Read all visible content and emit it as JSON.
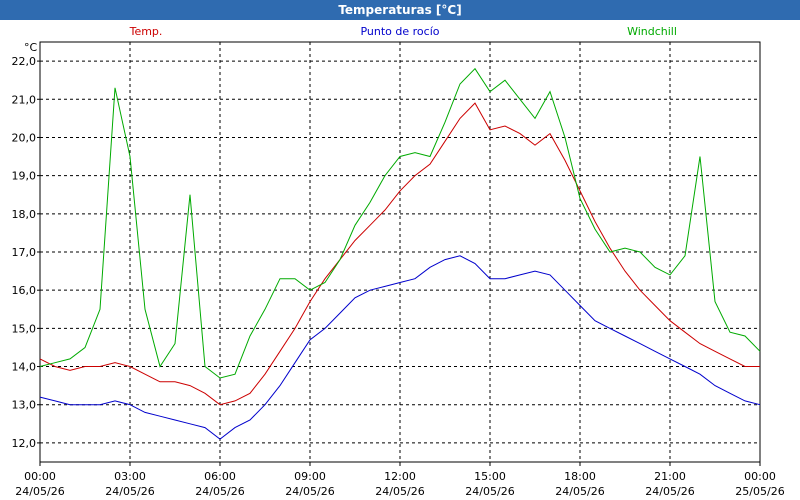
{
  "window": {
    "title": "Temperaturas [°C]"
  },
  "colors": {
    "temp": "#cc0000",
    "dew": "#0000cc",
    "wind": "#00aa00",
    "titlebar": "#2f6bb0"
  },
  "chart_data": {
    "type": "line",
    "title": "Temperaturas [°C]",
    "ylabel": "°C",
    "ylim": [
      11.5,
      22.5
    ],
    "grid": true,
    "legend_position": "top",
    "yticks": [
      "12,0",
      "13,0",
      "14,0",
      "15,0",
      "16,0",
      "17,0",
      "18,0",
      "19,0",
      "20,0",
      "21,0",
      "22,0"
    ],
    "xticks": [
      {
        "time": "00:00",
        "date": "24/05/26"
      },
      {
        "time": "03:00",
        "date": "24/05/26"
      },
      {
        "time": "06:00",
        "date": "24/05/26"
      },
      {
        "time": "09:00",
        "date": "24/05/26"
      },
      {
        "time": "12:00",
        "date": "24/05/26"
      },
      {
        "time": "15:00",
        "date": "24/05/26"
      },
      {
        "time": "18:00",
        "date": "24/05/26"
      },
      {
        "time": "21:00",
        "date": "24/05/26"
      },
      {
        "time": "00:00",
        "date": "25/05/26"
      }
    ],
    "x_hours": [
      0,
      0.5,
      1,
      1.5,
      2,
      2.5,
      3,
      3.5,
      4,
      4.5,
      5,
      5.5,
      6,
      6.5,
      7,
      7.5,
      8,
      8.5,
      9,
      9.5,
      10,
      10.5,
      11,
      11.5,
      12,
      12.5,
      13,
      13.5,
      14,
      14.5,
      15,
      15.5,
      16,
      16.5,
      17,
      17.5,
      18,
      18.5,
      19,
      19.5,
      20,
      20.5,
      21,
      21.5,
      22,
      22.5,
      23,
      23.5,
      24
    ],
    "series": [
      {
        "name": "Temp.",
        "color": "#cc0000",
        "values": [
          14.2,
          14.0,
          13.9,
          14.0,
          14.0,
          14.1,
          14.0,
          13.8,
          13.6,
          13.6,
          13.5,
          13.3,
          13.0,
          13.1,
          13.3,
          13.8,
          14.4,
          15.0,
          15.7,
          16.3,
          16.8,
          17.3,
          17.7,
          18.1,
          18.6,
          19.0,
          19.3,
          19.9,
          20.5,
          20.9,
          20.2,
          20.3,
          20.1,
          19.8,
          20.1,
          19.4,
          18.6,
          17.8,
          17.1,
          16.5,
          16.0,
          15.6,
          15.2,
          14.9,
          14.6,
          14.4,
          14.2,
          14.0,
          14.0
        ]
      },
      {
        "name": "Punto de rocío",
        "color": "#0000cc",
        "values": [
          13.2,
          13.1,
          13.0,
          13.0,
          13.0,
          13.1,
          13.0,
          12.8,
          12.7,
          12.6,
          12.5,
          12.4,
          12.1,
          12.4,
          12.6,
          13.0,
          13.5,
          14.1,
          14.7,
          15.0,
          15.4,
          15.8,
          16.0,
          16.1,
          16.2,
          16.3,
          16.6,
          16.8,
          16.9,
          16.7,
          16.3,
          16.3,
          16.4,
          16.5,
          16.4,
          16.0,
          15.6,
          15.2,
          15.0,
          14.8,
          14.6,
          14.4,
          14.2,
          14.0,
          13.8,
          13.5,
          13.3,
          13.1,
          13.0
        ]
      },
      {
        "name": "Windchill",
        "color": "#00aa00",
        "values": [
          14.0,
          14.1,
          14.2,
          14.5,
          15.5,
          21.3,
          19.5,
          15.5,
          14.0,
          14.6,
          18.5,
          14.0,
          13.7,
          13.8,
          14.8,
          15.5,
          16.3,
          16.3,
          16.0,
          16.2,
          16.8,
          17.7,
          18.3,
          19.0,
          19.5,
          19.6,
          19.5,
          20.4,
          21.4,
          21.8,
          21.2,
          21.5,
          21.0,
          20.5,
          21.2,
          20.0,
          18.4,
          17.6,
          17.0,
          17.1,
          17.0,
          16.6,
          16.4,
          16.9,
          19.5,
          15.7,
          14.9,
          14.8,
          14.4
        ]
      }
    ]
  }
}
